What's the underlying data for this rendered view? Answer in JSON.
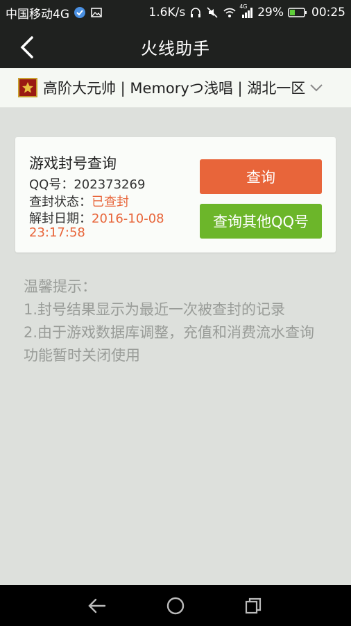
{
  "status_bar": {
    "carrier": "中国移动4G",
    "speed": "1.6K/s",
    "network_label": "4G",
    "battery": "29%",
    "time": "00:25"
  },
  "nav": {
    "title": "火线助手",
    "back_icon": "chevron-left-icon"
  },
  "account": {
    "text": "高阶大元帅 | Memoryつ浅唱 | 湖北一区",
    "badge_icon": "rank-badge-icon",
    "dropdown_icon": "chevron-down-icon"
  },
  "card": {
    "title": "游戏封号查询",
    "qq_label": "QQ号：",
    "qq_value": "202373269",
    "status_label": "查封状态：",
    "status_value": "已查封",
    "unban_label": "解封日期：",
    "unban_date": "2016-10-08",
    "unban_time": "23:17:58",
    "query_button": "查询",
    "other_button": "查询其他QQ号"
  },
  "tips": {
    "heading": "温馨提示：",
    "items": [
      "1.封号结果显示为最近一次被查封的记录",
      "2.由于游戏数据库调整，充值和消费流水查询功能暂时关闭使用"
    ]
  },
  "colors": {
    "accent_orange": "#e8653a",
    "accent_green": "#6cb62a",
    "header_bg": "#1f211f",
    "page_bg": "#dde0dc"
  }
}
